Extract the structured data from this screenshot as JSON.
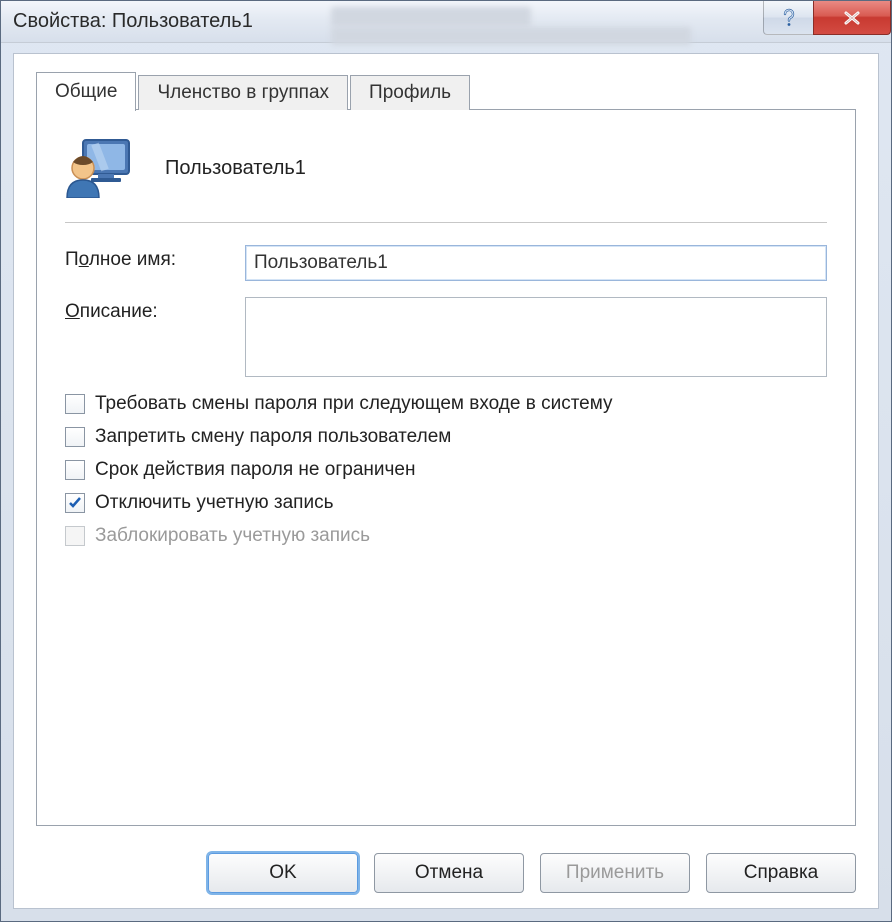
{
  "window": {
    "title": "Свойства: Пользователь1"
  },
  "tabs": [
    {
      "label": "Общие",
      "active": true
    },
    {
      "label": "Членство в группах",
      "active": false
    },
    {
      "label": "Профиль",
      "active": false
    }
  ],
  "user": {
    "display_name": "Пользователь1"
  },
  "fields": {
    "full_name_label_pre": "П",
    "full_name_label_ul": "о",
    "full_name_label_post": "лное имя:",
    "full_name_value": "Пользователь1",
    "description_label_ul": "О",
    "description_label_post": "писание:",
    "description_value": ""
  },
  "checks": {
    "require_change": {
      "label": "Требовать смены пароля при следующем входе в систему",
      "checked": false,
      "enabled": true
    },
    "deny_change": {
      "label_ul": "З",
      "label_post": "апретить смену пароля пользователем",
      "checked": false,
      "enabled": true
    },
    "never_expires": {
      "label_ul": "С",
      "label_post": "рок действия пароля не ограничен",
      "checked": false,
      "enabled": true
    },
    "disable_acct": {
      "label_pre": "От",
      "label_ul": "к",
      "label_post": "лючить учетную запись",
      "checked": true,
      "enabled": true
    },
    "locked": {
      "label": "Заблокировать учетную запись",
      "checked": false,
      "enabled": false
    }
  },
  "buttons": {
    "ok": "OK",
    "cancel": "Отмена",
    "apply": "Применить",
    "help": "Справка"
  }
}
